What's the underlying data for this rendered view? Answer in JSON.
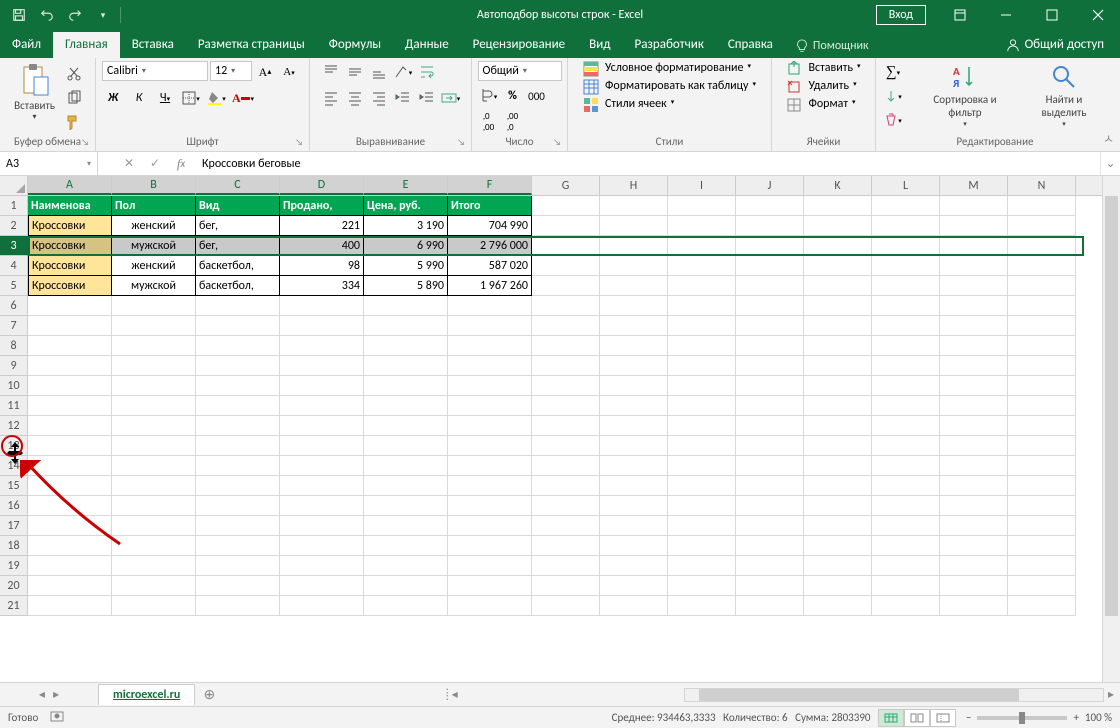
{
  "title": "Автоподбор высоты строк - Excel",
  "signin": "Вход",
  "menu": {
    "file": "Файл",
    "home": "Главная",
    "insert": "Вставка",
    "layout": "Разметка страницы",
    "formulas": "Формулы",
    "data": "Данные",
    "review": "Рецензирование",
    "view": "Вид",
    "developer": "Разработчик",
    "help": "Справка",
    "tellme": "Помощник",
    "share": "Общий доступ"
  },
  "ribbon": {
    "clipboard": {
      "paste": "Вставить",
      "label": "Буфер обмена"
    },
    "font": {
      "name": "Calibri",
      "size": "12",
      "label": "Шрифт"
    },
    "alignment": {
      "label": "Выравнивание"
    },
    "number": {
      "format": "Общий",
      "label": "Число"
    },
    "styles": {
      "cond": "Условное форматирование",
      "fmt_table": "Форматировать как таблицу",
      "cell_styles": "Стили ячеек",
      "label": "Стили"
    },
    "cells": {
      "insert": "Вставить",
      "delete": "Удалить",
      "format": "Формат",
      "label": "Ячейки"
    },
    "editing": {
      "sort": "Сортировка и фильтр",
      "find": "Найти и выделить",
      "label": "Редактирование"
    }
  },
  "namebox": "A3",
  "formula": "Кроссовки беговые",
  "columns": [
    "A",
    "B",
    "C",
    "D",
    "E",
    "F",
    "G",
    "H",
    "I",
    "J",
    "K",
    "L",
    "M",
    "N"
  ],
  "rowcount": 21,
  "header": [
    "Наименова",
    "Пол",
    "Вид",
    "Продано,",
    "Цена, руб.",
    "Итого"
  ],
  "rows": [
    [
      "Кроссовки",
      "женский",
      "бег,",
      "221",
      "3 190",
      "704 990"
    ],
    [
      "Кроссовки",
      "мужской",
      "бег,",
      "400",
      "6 990",
      "2 796 000"
    ],
    [
      "Кроссовки",
      "женский",
      "баскетбол,",
      "98",
      "5 990",
      "587 020"
    ],
    [
      "Кроссовки",
      "мужской",
      "баскетбол,",
      "334",
      "5 890",
      "1 967 260"
    ]
  ],
  "sheet": "microexcel.ru",
  "status": {
    "ready": "Готово",
    "avg_l": "Среднее:",
    "avg": "934463,3333",
    "cnt_l": "Количество:",
    "cnt": "6",
    "sum_l": "Сумма:",
    "sum": "2803390",
    "zoom": "100 %"
  },
  "chart_data": null
}
